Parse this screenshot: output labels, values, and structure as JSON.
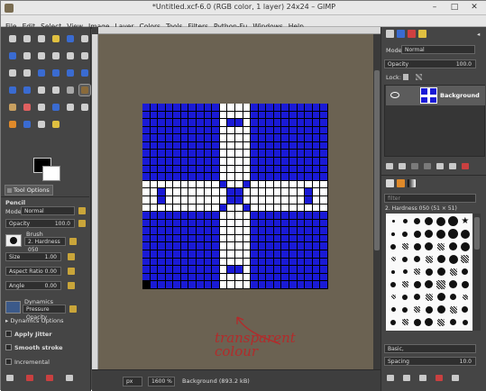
{
  "window": {
    "title": "*Untitled.xcf-6.0 (RGB color, 1 layer) 24x24 – GIMP",
    "minimize": "–",
    "maximize": "□",
    "close": "✕"
  },
  "menu": [
    "File",
    "Edit",
    "Select",
    "View",
    "Image",
    "Layer",
    "Colors",
    "Tools",
    "Filters",
    "Python-Fu",
    "Windows",
    "Help"
  ],
  "tool_options": {
    "tab_label": "Tool Options",
    "tool_name": "Pencil",
    "mode_label": "Mode:",
    "mode_value": "Normal",
    "opacity_label": "Opacity",
    "opacity_value": "100.0",
    "brush_label": "Brush",
    "brush_value": "2. Hardness 050",
    "size_label": "Size",
    "size_value": "1.00",
    "aspect_label": "Aspect Ratio",
    "aspect_value": "0.00",
    "angle_label": "Angle",
    "angle_value": "0.00",
    "dynamics_label": "Dynamics",
    "dynamics_value": "Pressure Opacity",
    "dynamics_options": "Dynamics Options",
    "apply_jitter": "Apply Jitter",
    "smooth_stroke": "Smooth stroke",
    "incremental": "Incremental"
  },
  "canvas": {
    "grid_size": 24,
    "annotation_lines": [
      "transparent",
      "colour"
    ]
  },
  "status": {
    "unit": "px",
    "zoom": "1600 %",
    "text": "Background (893.2 kB)"
  },
  "layers": {
    "mode_label": "Mode:",
    "mode_value": "Normal",
    "opacity_label": "Opacity",
    "opacity_value": "100.0",
    "lock_label": "Lock:",
    "layer_name": "Background"
  },
  "brushes": {
    "filter_placeholder": "filter",
    "selected": "2. Hardness 050 (51 × 51)",
    "tag": "Basic,",
    "spacing_label": "Spacing",
    "spacing_value": "10.0"
  },
  "colors": {
    "blue": "#1a1ad6",
    "white": "#ffffff",
    "transparent": "#000000",
    "annotation": "#b22b2b"
  }
}
